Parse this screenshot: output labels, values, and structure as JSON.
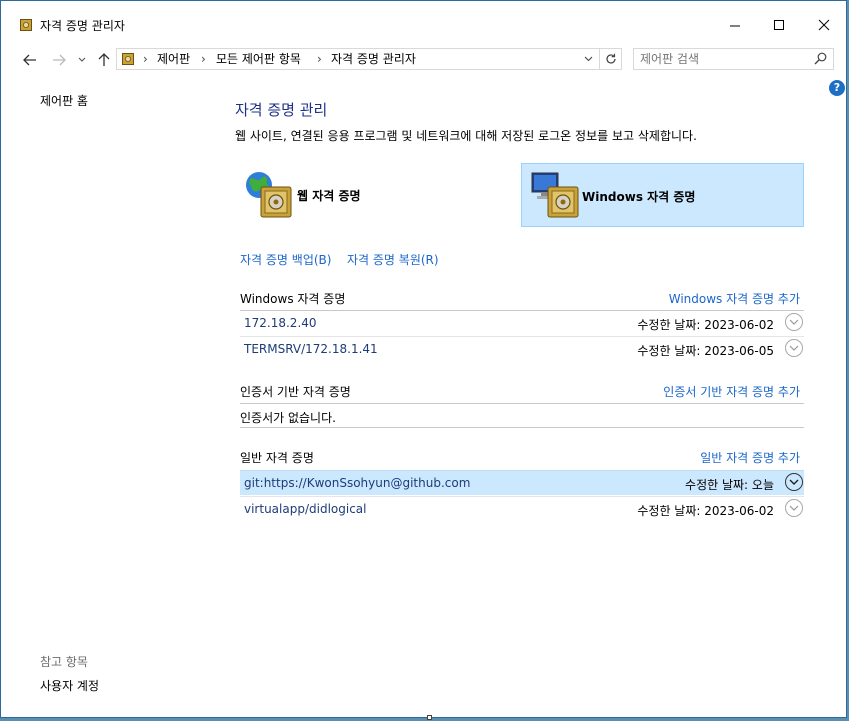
{
  "window": {
    "title": "자격 증명 관리자",
    "icon": "vault-icon"
  },
  "address": {
    "crumbs": [
      "제어판",
      "모든 제어판 항목",
      "자격 증명 관리자"
    ],
    "search_placeholder": "제어판 검색"
  },
  "sidebar": {
    "home": "제어판 홈",
    "see_also": "참고 항목",
    "user_accounts": "사용자 계정"
  },
  "main": {
    "heading": "자격 증명 관리",
    "description": "웹 사이트, 연결된 응용 프로그램 및 네트워크에 대해 저장된 로그온 정보를 보고 삭제합니다.",
    "tiles": {
      "web": "웹 자격 증명",
      "windows": "Windows 자격 증명"
    },
    "backup_link": "자격 증명 백업(B)",
    "restore_link": "자격 증명 복원(R)"
  },
  "sections": {
    "windows": {
      "title": "Windows 자격 증명",
      "add": "Windows 자격 증명 추가",
      "rows": [
        {
          "name": "172.18.2.40",
          "modified": "수정한 날짜:  2023-06-02"
        },
        {
          "name": "TERMSRV/172.18.1.41",
          "modified": "수정한 날짜:  2023-06-05"
        }
      ]
    },
    "certificate": {
      "title": "인증서 기반 자격 증명",
      "add": "인증서 기반 자격 증명 추가",
      "empty": "인증서가 없습니다."
    },
    "generic": {
      "title": "일반 자격 증명",
      "add": "일반 자격 증명 추가",
      "rows": [
        {
          "name": "git:https://KwonSsohyun@github.com",
          "modified": "수정한 날짜:  오늘"
        },
        {
          "name": "virtualapp/didlogical",
          "modified": "수정한 날짜:  2023-06-02"
        }
      ]
    }
  },
  "colors": {
    "link": "#1a66cc",
    "heading": "#1e3287",
    "selected": "#cce8ff"
  }
}
